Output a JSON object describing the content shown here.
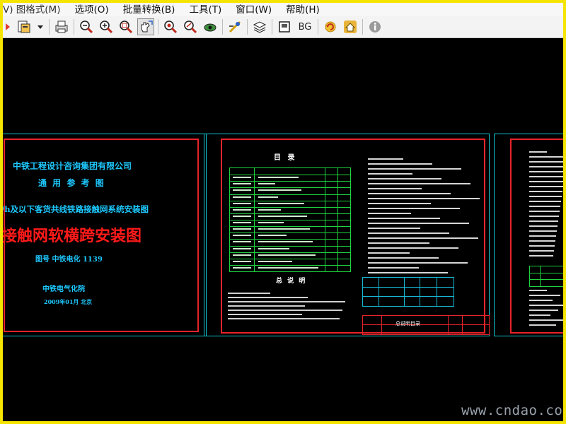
{
  "menubar": {
    "items": [
      {
        "id": "format",
        "label": "V) 图格式(M)"
      },
      {
        "id": "options",
        "label": "选项(O)"
      },
      {
        "id": "batch",
        "label": "批量转换(B)"
      },
      {
        "id": "tools",
        "label": "工具(T)"
      },
      {
        "id": "window",
        "label": "窗口(W)"
      },
      {
        "id": "help",
        "label": "帮助(H)"
      }
    ]
  },
  "toolbar": {
    "bg_label": "BG",
    "icons": [
      "open-file-icon",
      "dropdown-arrow-icon",
      "print-icon",
      "zoom-out-icon",
      "zoom-in-icon",
      "zoom-window-icon",
      "pan-hand-icon",
      "zoom-extents-icon",
      "zoom-realtime-icon",
      "layer-eye-icon",
      "measure-icon",
      "layers-icon",
      "print-preview-icon",
      "bg-color-button",
      "reload-icon",
      "home-icon",
      "about-icon"
    ]
  },
  "sheet1": {
    "company": "中铁工程设计咨询集团有限公司",
    "subtitle": "通 用 参 考 图",
    "system_line": "/h及以下客货共线铁路接触网系统安装图",
    "main_title": "接触网软横跨安装图",
    "drawing_no": "图号   中铁电化 1139",
    "institute": "中铁电气化院",
    "date": "2009年01月  北京"
  },
  "sheet2": {
    "catalog_title": "目 录",
    "notes_title": "总 说 明",
    "titleblock_label": "总说明目录",
    "catalog_rows": 15
  },
  "watermark": "www.cndao.com",
  "colors": {
    "canvas": "#000000",
    "sheet_border": "#10c6d2",
    "frame_red": "#e8232b",
    "title_cyan": "#1ec9ff",
    "title_red": "#ff1a1a",
    "table_green": "#1fd43f",
    "window_border": "#f5e400"
  }
}
